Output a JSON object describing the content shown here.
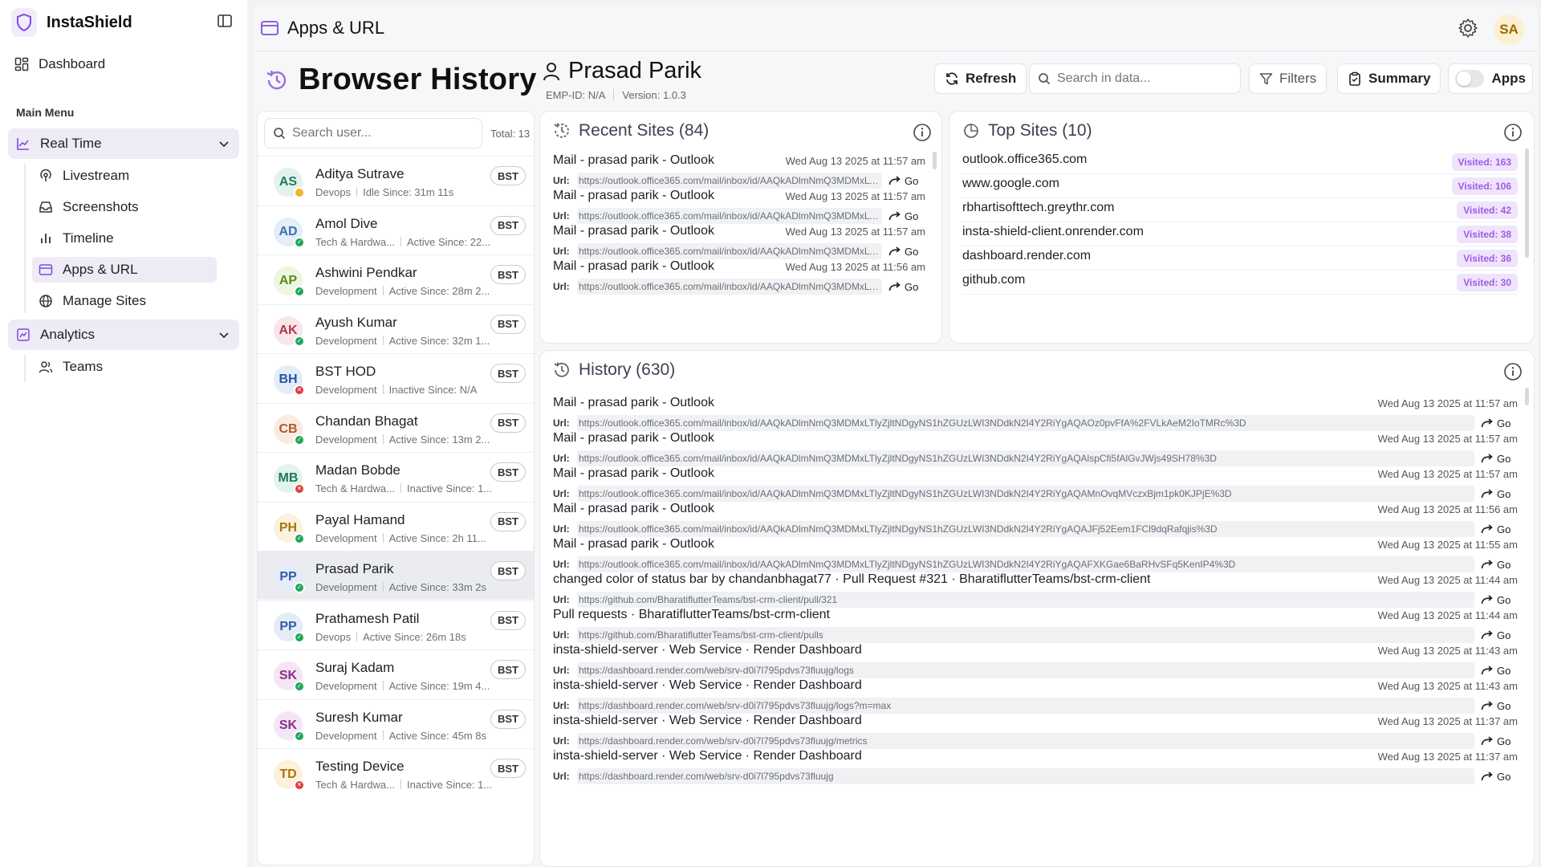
{
  "app": {
    "name": "InstaShield",
    "avatar_initials": "SA"
  },
  "sidebar": {
    "dashboard_label": "Dashboard",
    "menu_label": "Main Menu",
    "groups": [
      {
        "label": "Real Time",
        "items": [
          "Livestream",
          "Screenshots",
          "Timeline",
          "Apps & URL",
          "Manage Sites"
        ]
      },
      {
        "label": "Analytics",
        "items": [
          "Teams"
        ]
      }
    ],
    "active_item": "Apps & URL"
  },
  "header": {
    "title": "Apps & URL"
  },
  "page": {
    "title": "Browser History",
    "person_name": "Prasad Parik",
    "emp_id": "EMP-ID: N/A",
    "version": "Version: 1.0.3"
  },
  "toolbar": {
    "refresh": "Refresh",
    "search_placeholder": "Search in data...",
    "filters": "Filters",
    "summary": "Summary",
    "apps": "Apps"
  },
  "users_panel": {
    "search_placeholder": "Search user...",
    "total": "Total: 13",
    "users": [
      {
        "initials": "AS",
        "name": "Aditya Sutrave",
        "dept": "Devops",
        "status_text": "Idle Since: 31m 11s",
        "badge": "BST",
        "status": "idle",
        "color": "#1f7a5a",
        "bg": "#e3f3ec"
      },
      {
        "initials": "AD",
        "name": "Amol Dive",
        "dept": "Tech & Hardwa...",
        "status_text": "Active Since: 22...",
        "badge": "BST",
        "status": "active",
        "color": "#3c6fb5",
        "bg": "#e4edf8"
      },
      {
        "initials": "AP",
        "name": "Ashwini Pendkar",
        "dept": "Development",
        "status_text": "Active Since: 28m 2...",
        "badge": "BST",
        "status": "active",
        "color": "#5e8a1e",
        "bg": "#eef5e1"
      },
      {
        "initials": "AK",
        "name": "Ayush Kumar",
        "dept": "Development",
        "status_text": "Active Since: 32m 1...",
        "badge": "BST",
        "status": "active",
        "color": "#b03a48",
        "bg": "#f8e6e9"
      },
      {
        "initials": "BH",
        "name": "BST HOD",
        "dept": "Development",
        "status_text": "Inactive Since: N/A",
        "badge": "BST",
        "status": "inactive",
        "color": "#2456a6",
        "bg": "#e4ecf8"
      },
      {
        "initials": "CB",
        "name": "Chandan Bhagat",
        "dept": "Development",
        "status_text": "Active Since: 13m 2...",
        "badge": "BST",
        "status": "active",
        "color": "#b0582a",
        "bg": "#f9ebe2"
      },
      {
        "initials": "MB",
        "name": "Madan Bobde",
        "dept": "Tech & Hardwa...",
        "status_text": "Inactive Since: 1...",
        "badge": "BST",
        "status": "inactive",
        "color": "#1d7a55",
        "bg": "#e2f3eb"
      },
      {
        "initials": "PH",
        "name": "Payal Hamand",
        "dept": "Development",
        "status_text": "Active Since: 2h 11...",
        "badge": "BST",
        "status": "active",
        "color": "#a8760c",
        "bg": "#fbf1dc"
      },
      {
        "initials": "PP",
        "name": "Prasad Parik",
        "dept": "Development",
        "status_text": "Active Since: 33m 2s",
        "badge": "BST",
        "status": "active",
        "color": "#2f5ea8",
        "bg": "#e5ecf7"
      },
      {
        "initials": "PP",
        "name": "Prathamesh Patil",
        "dept": "Devops",
        "status_text": "Active Since: 26m 18s",
        "badge": "BST",
        "status": "active",
        "color": "#2f5ea8",
        "bg": "#e5ecf7"
      },
      {
        "initials": "SK",
        "name": "Suraj Kadam",
        "dept": "Development",
        "status_text": "Active Since: 19m 4...",
        "badge": "BST",
        "status": "active",
        "color": "#8a2f8a",
        "bg": "#f4e6f4"
      },
      {
        "initials": "SK",
        "name": "Suresh Kumar",
        "dept": "Development",
        "status_text": "Active Since: 45m 8s",
        "badge": "BST",
        "status": "active",
        "color": "#8a2f8a",
        "bg": "#f4e6f4"
      },
      {
        "initials": "TD",
        "name": "Testing Device",
        "dept": "Tech & Hardwa...",
        "status_text": "Inactive Since: 1...",
        "badge": "BST",
        "status": "inactive",
        "color": "#a8760c",
        "bg": "#fbf1dc"
      }
    ]
  },
  "recent_sites": {
    "title": "Recent Sites (84)",
    "url_label": "Url:",
    "go_label": "Go",
    "items": [
      {
        "title": "Mail - prasad parik - Outlook",
        "time": "Wed Aug 13 2025 at 11:57 am",
        "url": "https://outlook.office365.com/mail/inbox/id/AAQkADlmNmQ3MDMxLTlyZjl..."
      },
      {
        "title": "Mail - prasad parik - Outlook",
        "time": "Wed Aug 13 2025 at 11:57 am",
        "url": "https://outlook.office365.com/mail/inbox/id/AAQkADlmNmQ3MDMxLTlyZjl..."
      },
      {
        "title": "Mail - prasad parik - Outlook",
        "time": "Wed Aug 13 2025 at 11:57 am",
        "url": "https://outlook.office365.com/mail/inbox/id/AAQkADlmNmQ3MDMxLTlyZjl..."
      },
      {
        "title": "Mail - prasad parik - Outlook",
        "time": "Wed Aug 13 2025 at 11:56 am",
        "url": "https://outlook.office365.com/mail/inbox/id/AAQkADlmNmQ3MDMxLTlyZjl..."
      }
    ]
  },
  "top_sites": {
    "title": "Top Sites (10)",
    "items": [
      {
        "domain": "outlook.office365.com",
        "visited": "Visited: 163"
      },
      {
        "domain": "www.google.com",
        "visited": "Visited: 106"
      },
      {
        "domain": "rbhartisofttech.greythr.com",
        "visited": "Visited: 42"
      },
      {
        "domain": "insta-shield-client.onrender.com",
        "visited": "Visited: 38"
      },
      {
        "domain": "dashboard.render.com",
        "visited": "Visited: 36"
      },
      {
        "domain": "github.com",
        "visited": "Visited: 30"
      }
    ]
  },
  "history": {
    "title": "History (630)",
    "url_label": "Url:",
    "go_label": "Go",
    "items": [
      {
        "title": "Mail - prasad parik - Outlook",
        "time": "Wed Aug 13 2025 at 11:57 am",
        "url": "https://outlook.office365.com/mail/inbox/id/AAQkADlmNmQ3MDMxLTlyZjltNDgyNS1hZGUzLWI3NDdkN2I4Y2RiYgAQAOz0pvFfA%2FVLkAeM2IoTMRc%3D"
      },
      {
        "title": "Mail - prasad parik - Outlook",
        "time": "Wed Aug 13 2025 at 11:57 am",
        "url": "https://outlook.office365.com/mail/inbox/id/AAQkADlmNmQ3MDMxLTlyZjltNDgyNS1hZGUzLWI3NDdkN2I4Y2RiYgAQAlspCfi5fAlGvJWjs49SH78%3D"
      },
      {
        "title": "Mail - prasad parik - Outlook",
        "time": "Wed Aug 13 2025 at 11:57 am",
        "url": "https://outlook.office365.com/mail/inbox/id/AAQkADlmNmQ3MDMxLTlyZjltNDgyNS1hZGUzLWI3NDdkN2I4Y2RiYgAQAMnOvqMVczxBjm1pk0KJPjE%3D"
      },
      {
        "title": "Mail - prasad parik - Outlook",
        "time": "Wed Aug 13 2025 at 11:56 am",
        "url": "https://outlook.office365.com/mail/inbox/id/AAQkADlmNmQ3MDMxLTlyZjltNDgyNS1hZGUzLWI3NDdkN2I4Y2RiYgAQAJFj52Eem1FCl9dqRafqjis%3D"
      },
      {
        "title": "Mail - prasad parik - Outlook",
        "time": "Wed Aug 13 2025 at 11:55 am",
        "url": "https://outlook.office365.com/mail/inbox/id/AAQkADlmNmQ3MDMxLTlyZjltNDgyNS1hZGUzLWI3NDdkN2I4Y2RiYgAQAFXKGae6BaRHvSFq5KenIP4%3D"
      },
      {
        "title": "changed color of status bar by chandanbhagat77 · Pull Request #321 · BharatiflutterTeams/bst-crm-client",
        "time": "Wed Aug 13 2025 at 11:44 am",
        "url": "https://github.com/BharatiflutterTeams/bst-crm-client/pull/321"
      },
      {
        "title": "Pull requests · BharatiflutterTeams/bst-crm-client",
        "time": "Wed Aug 13 2025 at 11:44 am",
        "url": "https://github.com/BharatiflutterTeams/bst-crm-client/pulls"
      },
      {
        "title": "insta-shield-server · Web Service · Render Dashboard",
        "time": "Wed Aug 13 2025 at 11:43 am",
        "url": "https://dashboard.render.com/web/srv-d0i7l795pdvs73fluujg/logs"
      },
      {
        "title": "insta-shield-server · Web Service · Render Dashboard",
        "time": "Wed Aug 13 2025 at 11:43 am",
        "url": "https://dashboard.render.com/web/srv-d0i7l795pdvs73fluujg/logs?m=max"
      },
      {
        "title": "insta-shield-server · Web Service · Render Dashboard",
        "time": "Wed Aug 13 2025 at 11:37 am",
        "url": "https://dashboard.render.com/web/srv-d0i7l795pdvs73fluujg/metrics"
      },
      {
        "title": "insta-shield-server · Web Service · Render Dashboard",
        "time": "Wed Aug 13 2025 at 11:37 am",
        "url": "https://dashboard.render.com/web/srv-d0i7l795pdvs73fluujg"
      }
    ]
  },
  "colors": {
    "accent": "#7c4dde",
    "visited_bg": "#efe4fb",
    "visited_text": "#9b5de5",
    "active_status": "#22a55b",
    "inactive_status": "#e03a3a",
    "idle_status": "#f2b52b"
  }
}
